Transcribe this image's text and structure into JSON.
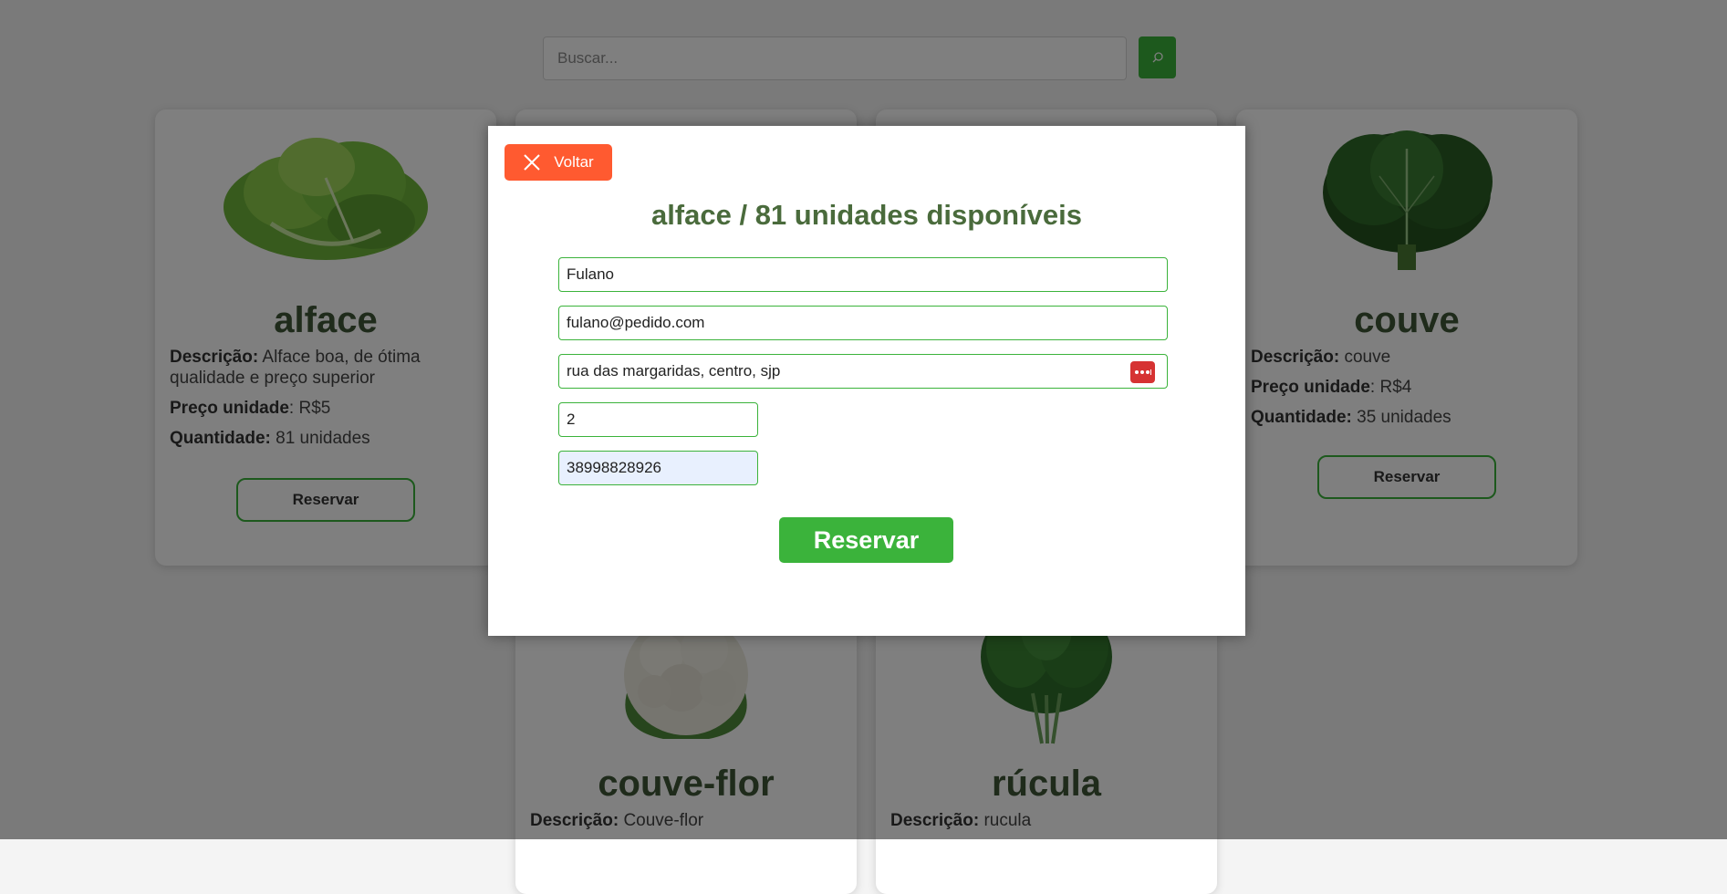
{
  "search": {
    "placeholder": "Buscar..."
  },
  "labels": {
    "description": "Descrição:",
    "unit_price": "Preço unidade",
    "quantity": "Quantidade:"
  },
  "products": [
    {
      "name": "alface",
      "description": "Alface boa, de ótima qualidade e preço superior",
      "price": ": R$5",
      "quantity": " 81 unidades",
      "button": "Reservar",
      "icon": "lettuce-image"
    },
    {
      "name": "couve",
      "description": "couve",
      "price": ": R$4",
      "quantity": " 35 unidades",
      "button": "Reservar",
      "icon": "collard-greens-image"
    },
    {
      "name": "couve-flor",
      "description": "Couve-flor",
      "icon": "cauliflower-image"
    },
    {
      "name": "rúcula",
      "description": "rucula",
      "icon": "arugula-image"
    }
  ],
  "modal": {
    "back_label": "Voltar",
    "title": "alface /  81 unidades disponíveis",
    "fields": {
      "name": "Fulano",
      "email": "fulano@pedido.com",
      "address": "rua das margaridas, centro, sjp",
      "quantity": "2",
      "phone": "38998828926"
    },
    "submit_label": "Reservar"
  },
  "colors": {
    "accent": "#3bb33b",
    "back_button": "#ff5a30",
    "heading": "#3e5636"
  }
}
